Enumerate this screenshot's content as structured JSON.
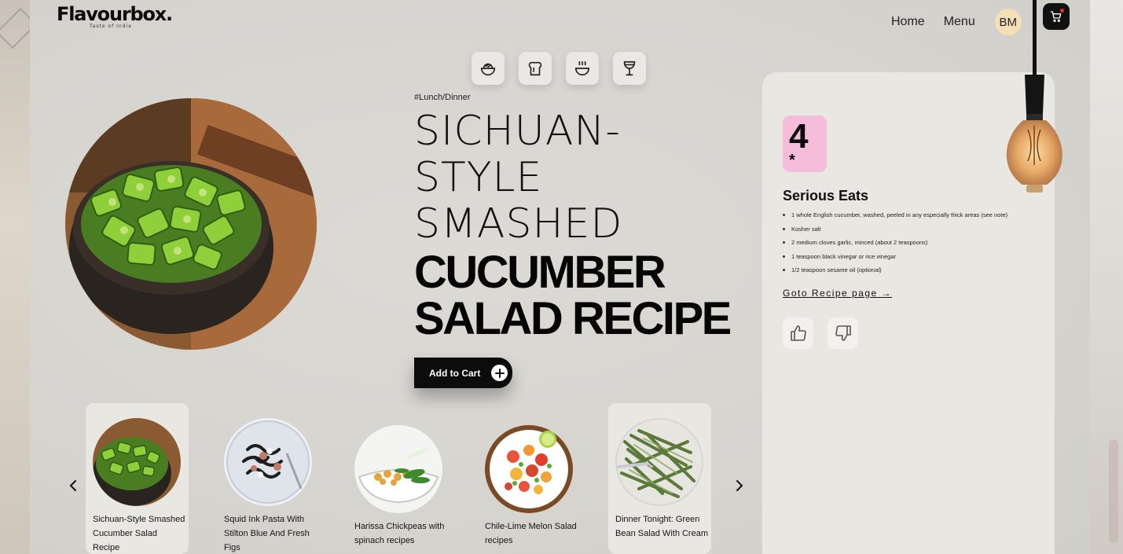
{
  "brand": {
    "name": "Flavourbox.",
    "tagline": "Taste of India"
  },
  "nav": {
    "home": "Home",
    "menu": "Menu",
    "avatar_initials": "BM"
  },
  "category_icons": [
    "rice-bowl-icon",
    "toast-icon",
    "hot-soup-icon",
    "drink-glass-icon"
  ],
  "hero": {
    "tag": "#Lunch/Dinner",
    "title_light": [
      "SICHUAN-",
      "STYLE",
      "SMASHED"
    ],
    "title_bold": [
      "CUCUMBER",
      "SALAD RECIPE"
    ],
    "add_to_cart": "Add to Cart"
  },
  "recipe_panel": {
    "rating": "4",
    "rating_star": "*",
    "source": "Serious Eats",
    "ingredients": [
      "1 whole English cucumber, washed, peeled in any especially thick areas (see note)",
      "Kosher salt",
      "2 medium cloves garlic, minced (about 2 teaspoons)",
      "1 teaspoon black vinegar or rice vinegar",
      "1/2 teaspoon sesame oil (optional)"
    ],
    "goto_link": "Goto Recipe page →"
  },
  "carousel": [
    {
      "title": "Sichuan-Style Smashed Cucumber Salad Recipe",
      "active": true
    },
    {
      "title": "Squid Ink Pasta With Stilton Blue And Fresh Figs",
      "active": false
    },
    {
      "title": "Harissa Chickpeas with spinach recipes",
      "active": false
    },
    {
      "title": "Chile-Lime Melon Salad recipes",
      "active": false
    },
    {
      "title": "Dinner Tonight: Green Bean Salad With Cream",
      "active": true
    }
  ],
  "colors": {
    "accent_pink": "#f5bdd9",
    "avatar_bg": "#f4dfb9",
    "cart_dot": "#e3312f",
    "dark": "#0c0c0c"
  }
}
